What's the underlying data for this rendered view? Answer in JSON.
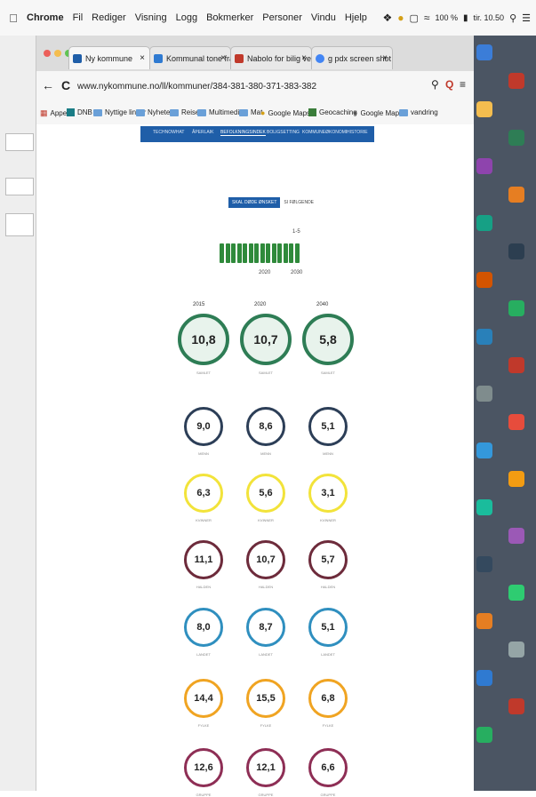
{
  "menubar": {
    "items": [
      "Chrome",
      "Fil",
      "Rediger",
      "Visning",
      "Logg",
      "Bokmerker",
      "Personer",
      "Vindu",
      "Hjelp"
    ],
    "battery": "100 %",
    "clock": "tir. 10.50"
  },
  "tabs": [
    {
      "label": "Ny kommune",
      "color": "#1f5ea8"
    },
    {
      "label": "Kommunal tone fra time fu",
      "color": "#2f7ad1"
    },
    {
      "label": "Nabolo for bilig verdenser",
      "color": "#c0392b"
    },
    {
      "label": "g pdx screen shot - Google",
      "color": "#4285f4"
    }
  ],
  "address": "www.nykommune.no/ll/kommuner/384-381-380-371-383-382",
  "bookmarks": [
    "Apper",
    "DNB",
    "Nyttige linker",
    "Nyheter",
    "Reise",
    "Multimedia",
    "Mat",
    "Google Maps",
    "Geocaching",
    "Google Maps",
    "vandring"
  ],
  "page": {
    "nav_tabs": [
      "TECHNOWHAT",
      "ÅPERLAIK",
      "BEFOLKNINGSINDEK",
      "BOLIGSETTING",
      "KOMMUNEØKONOMI",
      "HISTORIE"
    ],
    "nav_selected_index": 2,
    "toggle": [
      "SKAL DØDE ØNSKET",
      "SI FØLGENDE"
    ],
    "slider": {
      "top_label": "1-5",
      "bottom_left_label": "2020",
      "bottom_right_label": "2030",
      "marks": 14
    },
    "columns": [
      "2015",
      "2020",
      "2040"
    ],
    "rows": [
      {
        "values": [
          "10,8",
          "10,7",
          "5,8"
        ],
        "label": "SAMLET",
        "color": "#2e7d55",
        "fill": "#e8f3ec",
        "size": "big"
      },
      {
        "values": [
          "9,0",
          "8,6",
          "5,1"
        ],
        "label": "MENN",
        "color": "#2c3e57",
        "fill": "#ffffff",
        "size": "small"
      },
      {
        "values": [
          "6,3",
          "5,6",
          "3,1"
        ],
        "label": "KVINNER",
        "color": "#f2e33a",
        "fill": "#ffffff",
        "size": "small"
      },
      {
        "values": [
          "11,1",
          "10,7",
          "5,7"
        ],
        "label": "HALDEN",
        "color": "#6d2b3b",
        "fill": "#ffffff",
        "size": "small"
      },
      {
        "values": [
          "8,0",
          "8,7",
          "5,1"
        ],
        "label": "LANDET",
        "color": "#2f8fbf",
        "fill": "#ffffff",
        "size": "small"
      },
      {
        "values": [
          "14,4",
          "15,5",
          "6,8"
        ],
        "label": "FYLKE",
        "color": "#f0a422",
        "fill": "#ffffff",
        "size": "small"
      },
      {
        "values": [
          "12,6",
          "12,1",
          "6,6"
        ],
        "label": "GRUPPE",
        "color": "#8e2e55",
        "fill": "#ffffff",
        "size": "small"
      }
    ]
  }
}
